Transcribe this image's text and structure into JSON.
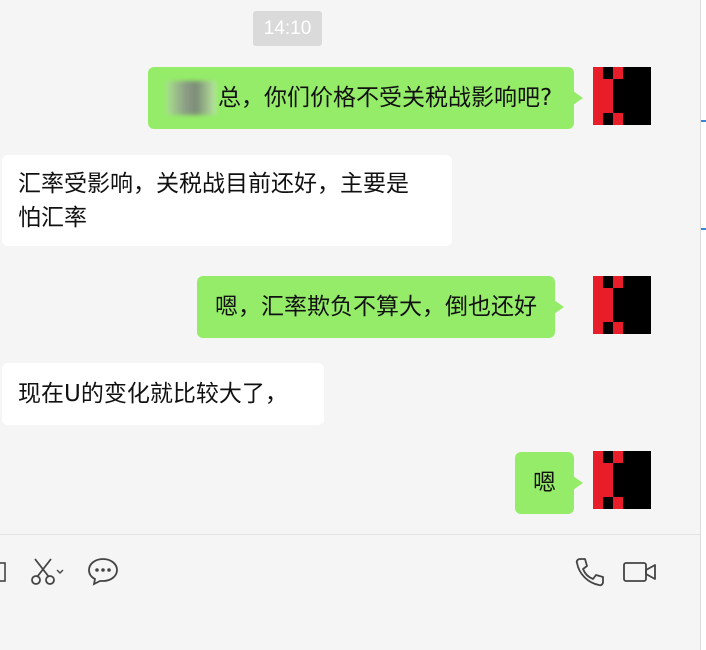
{
  "timestamp": "14:10",
  "messages": [
    {
      "id": "m1",
      "direction": "out",
      "text": "总，你们价格不受关税战影响吧?"
    },
    {
      "id": "m2",
      "direction": "in",
      "lines": [
        "汇率受影响，关税战目前还好，主要是",
        "怕汇率"
      ]
    },
    {
      "id": "m3",
      "direction": "out",
      "text": "嗯，汇率欺负不算大，倒也还好"
    },
    {
      "id": "m4",
      "direction": "in",
      "text": "现在U的变化就比较大了，"
    },
    {
      "id": "m5",
      "direction": "out",
      "text": "嗯"
    }
  ],
  "toolbar": {
    "left": [
      "folder-icon",
      "scissors-icon",
      "chat-bubble-icon"
    ],
    "right": [
      "phone-icon",
      "video-call-icon"
    ]
  },
  "colors": {
    "outgoing_bubble": "#95ec69",
    "incoming_bubble": "#ffffff",
    "background": "#f5f5f5",
    "avatar_red": "#e81d2a",
    "avatar_black": "#000000"
  }
}
